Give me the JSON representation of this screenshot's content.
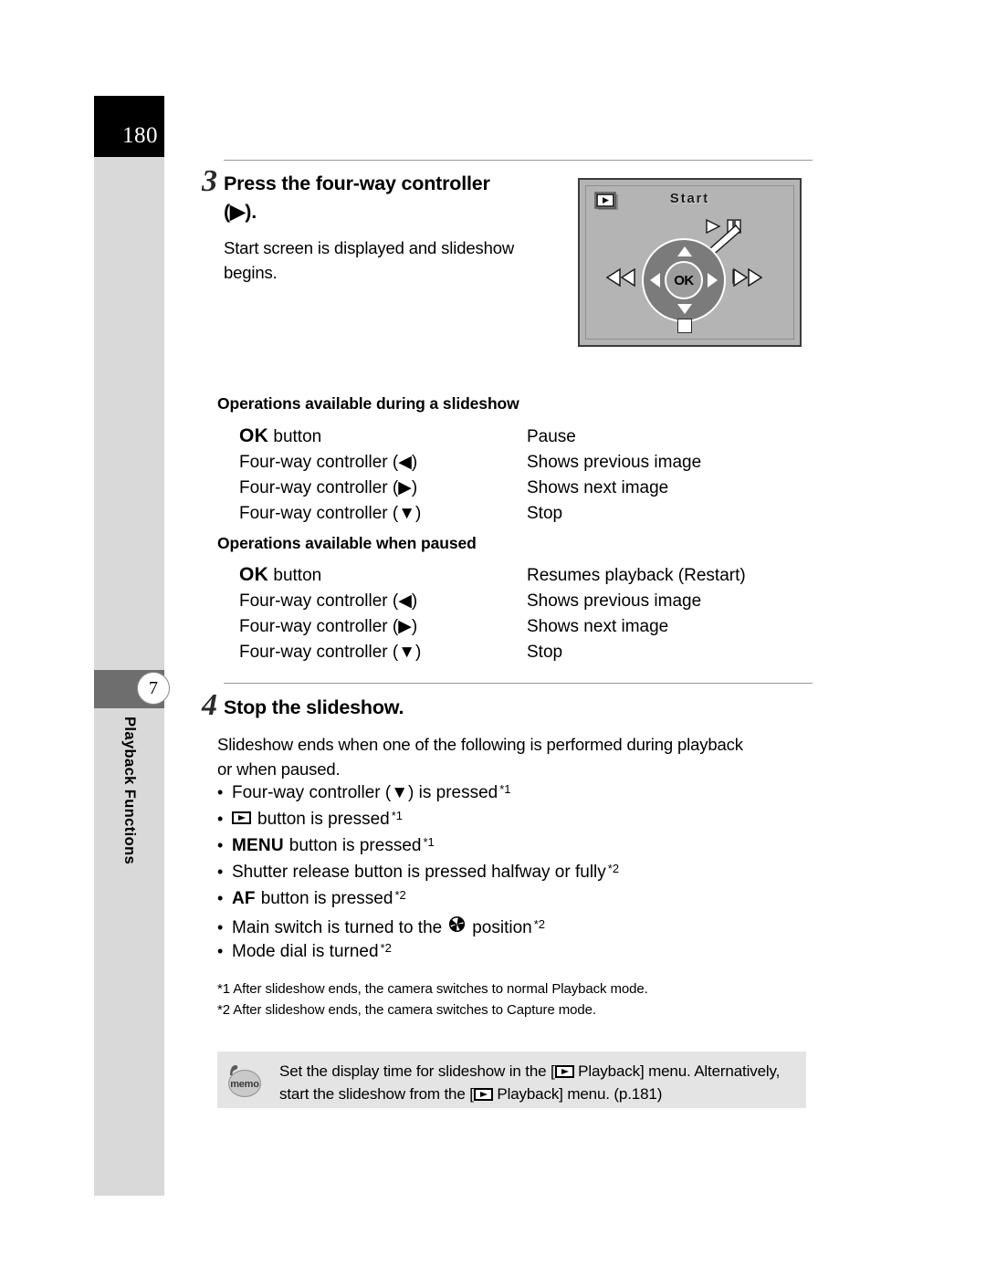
{
  "page": {
    "number": "180",
    "chapter_number": "7",
    "chapter_title": "Playback Functions"
  },
  "step3": {
    "number": "3",
    "heading_line1": "Press the four-way controller",
    "heading_line2": "(▶).",
    "body_line1": "Start screen is displayed and slideshow",
    "body_line2": "begins."
  },
  "lcd": {
    "playback_icon": "playback-stack-icon",
    "title": "Start",
    "pause_hint_icon": "play-pause-icon",
    "ok_label": "OK",
    "prev_icon": "rewind-icon",
    "next_icon": "fast-forward-icon",
    "stop_icon": "stop-square-icon",
    "up_icon": "arrow-up-icon",
    "down_icon": "arrow-down-icon",
    "left_icon": "arrow-left-icon",
    "right_icon": "arrow-right-icon"
  },
  "during_slideshow": {
    "heading": "Operations available during a slideshow",
    "rows": [
      {
        "key_bold": "OK",
        "key_rest": "button",
        "value": "Pause"
      },
      {
        "key_bold": "",
        "key_rest": "Four-way controller (◀)",
        "value": "Shows previous image"
      },
      {
        "key_bold": "",
        "key_rest": "Four-way controller (▶)",
        "value": "Shows next image"
      },
      {
        "key_bold": "",
        "key_rest": "Four-way controller (▼)",
        "value": "Stop"
      }
    ]
  },
  "when_paused": {
    "heading": "Operations available when paused",
    "rows": [
      {
        "key_bold": "OK",
        "key_rest": "button",
        "value": "Resumes playback (Restart)"
      },
      {
        "key_bold": "",
        "key_rest": "Four-way controller (◀)",
        "value": "Shows previous image"
      },
      {
        "key_bold": "",
        "key_rest": "Four-way controller (▶)",
        "value": "Shows next image"
      },
      {
        "key_bold": "",
        "key_rest": "Four-way controller (▼)",
        "value": "Stop"
      }
    ]
  },
  "step4": {
    "number": "4",
    "heading": "Stop the slideshow.",
    "body_line1": "Slideshow ends when one of the following is performed during playback",
    "body_line2": "or when paused.",
    "bullets": [
      {
        "pre": "",
        "bold": "",
        "text": "Four-way controller (▼) is pressed",
        "sup": "*1",
        "icon": ""
      },
      {
        "pre": "",
        "bold": "",
        "text": "button is pressed",
        "sup": "*1",
        "icon": "playback-button-icon"
      },
      {
        "pre": "",
        "bold": "MENU",
        "text": "button is pressed",
        "sup": "*1",
        "icon": ""
      },
      {
        "pre": "",
        "bold": "",
        "text": "Shutter release button is pressed halfway or fully",
        "sup": "*2",
        "icon": ""
      },
      {
        "pre": "",
        "bold": "AF",
        "text": "button is pressed",
        "sup": "*2",
        "icon": ""
      },
      {
        "pre": "Main switch is turned to the",
        "bold": "",
        "text": "position",
        "sup": "*2",
        "icon": "aperture-icon"
      },
      {
        "pre": "",
        "bold": "",
        "text": "Mode dial is turned",
        "sup": "*2",
        "icon": ""
      }
    ],
    "footnotes": [
      "*1  After slideshow ends, the camera switches to normal Playback mode.",
      "*2  After slideshow ends, the camera switches to Capture mode."
    ]
  },
  "memo": {
    "icon_label": "memo",
    "line1_a": "Set the display time for slideshow in the [",
    "line1_b": "Playback] menu. Alternatively,",
    "line2_a": "start the slideshow from the [",
    "line2_b": "Playback] menu. (p.181)"
  },
  "colors": {
    "sidebar_bg": "#d9d9d9",
    "page_block_bg": "#000000",
    "chapter_band": "#6e6e6e",
    "memo_bg": "#e4e4e4",
    "lcd_bg": "#b4b4b4",
    "rule": "#9a9a9a"
  }
}
